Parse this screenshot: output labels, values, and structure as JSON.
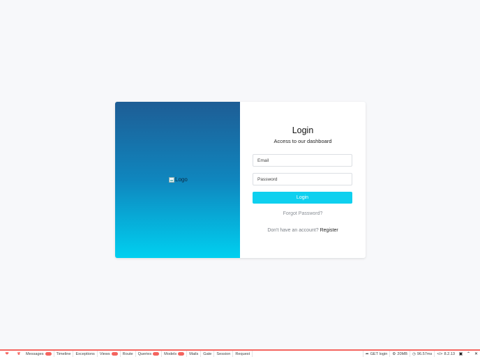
{
  "login": {
    "logo_alt": "Logo",
    "title": "Login",
    "subtitle": "Access to our dashboard",
    "email_placeholder": "Email",
    "password_placeholder": "Password",
    "button_label": "Login",
    "forgot_label": "Forgot Password?",
    "no_account_text": "Don't have an account?",
    "register_label": "Register"
  },
  "colors": {
    "accent": "#0fd0ef",
    "panel_top": "#1e5d95",
    "panel_bottom": "#00d0f0",
    "debugbar_accent": "#f4645f"
  },
  "debugbar": {
    "tabs": [
      {
        "label": "Messages",
        "badge": true
      },
      {
        "label": "Timeline",
        "badge": false
      },
      {
        "label": "Exceptions",
        "badge": false
      },
      {
        "label": "Views",
        "badge": true
      },
      {
        "label": "Route",
        "badge": false
      },
      {
        "label": "Queries",
        "badge": true
      },
      {
        "label": "Models",
        "badge": true
      },
      {
        "label": "Mails",
        "badge": false
      },
      {
        "label": "Gate",
        "badge": false
      },
      {
        "label": "Session",
        "badge": false
      },
      {
        "label": "Request",
        "badge": false
      }
    ],
    "request": "GET login",
    "memory": "20MB",
    "time": "96.57ms",
    "php_version": "8.2.13"
  }
}
